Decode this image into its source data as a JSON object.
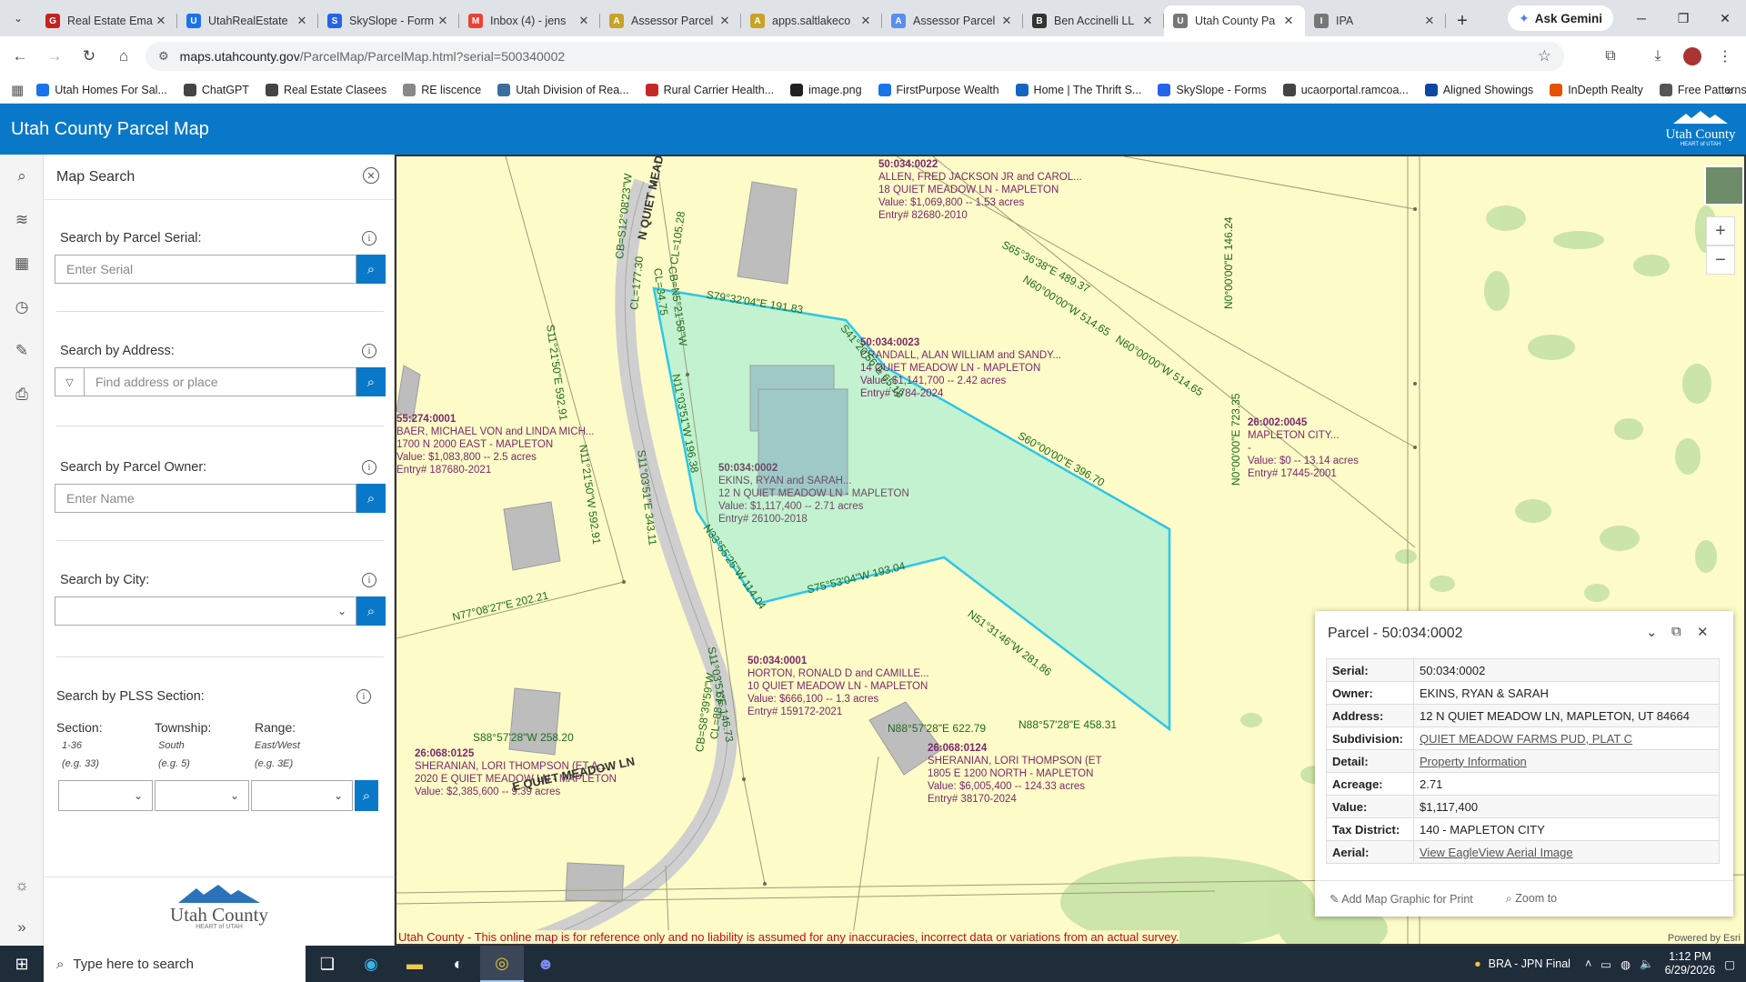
{
  "browser": {
    "tabs": [
      {
        "title": "Real Estate Ema",
        "color": "#c5221f",
        "glyph": "G"
      },
      {
        "title": "UtahRealEstate",
        "color": "#1a73e8",
        "glyph": "U"
      },
      {
        "title": "SkySlope - Form",
        "color": "#2563eb",
        "glyph": "S"
      },
      {
        "title": "Inbox (4) - jens",
        "color": "#ea4335",
        "glyph": "M"
      },
      {
        "title": "Assessor Parcel",
        "color": "#c9a227",
        "glyph": "A"
      },
      {
        "title": "apps.saltlakeco",
        "color": "#c9a227",
        "glyph": "A"
      },
      {
        "title": "Assessor Parcel",
        "color": "#5b8def",
        "glyph": "A"
      },
      {
        "title": "Ben Accinelli LL",
        "color": "#333333",
        "glyph": "B"
      },
      {
        "title": "Utah County Pa",
        "color": "#777777",
        "glyph": "U",
        "active": true
      },
      {
        "title": "IPA",
        "color": "#777777",
        "glyph": "I"
      }
    ],
    "gemini_label": "Ask Gemini",
    "url_host": "maps.utahcounty.gov",
    "url_path": "/ParcelMap/ParcelMap.html?serial=500340002",
    "bookmarks": [
      {
        "label": "Utah Homes For Sal...",
        "color": "#1a73e8"
      },
      {
        "label": "ChatGPT",
        "color": "#444444"
      },
      {
        "label": "Real Estate Clasees",
        "color": "#444444"
      },
      {
        "label": "RE liscence",
        "color": "#888888"
      },
      {
        "label": "Utah Division of Rea...",
        "color": "#3b6e9e"
      },
      {
        "label": "Rural Carrier Health...",
        "color": "#c62828"
      },
      {
        "label": "image.png",
        "color": "#222222"
      },
      {
        "label": "FirstPurpose Wealth",
        "color": "#1a73e8"
      },
      {
        "label": "Home | The Thrift S...",
        "color": "#1565c0"
      },
      {
        "label": "SkySlope - Forms",
        "color": "#2563eb"
      },
      {
        "label": "ucaorportal.ramcoa...",
        "color": "#444444"
      },
      {
        "label": "Aligned Showings",
        "color": "#0d47a1"
      },
      {
        "label": "InDepth Realty",
        "color": "#e65100"
      },
      {
        "label": "Free Patterns",
        "color": "#555555"
      }
    ]
  },
  "app": {
    "title": "Utah County Parcel Map",
    "logo_text": "Utah County",
    "logo_sub": "HEART of UTAH"
  },
  "panel": {
    "title": "Map Search",
    "serial_title": "Search by Parcel Serial:",
    "serial_placeholder": "Enter Serial",
    "address_title": "Search by Address:",
    "address_placeholder": "Find address or place",
    "owner_title": "Search by Parcel Owner:",
    "owner_placeholder": "Enter Name",
    "city_title": "Search by City:",
    "plss_title": "Search by PLSS Section:",
    "section_label": "Section:",
    "section_range": "1-36",
    "section_eg": "(e.g. 33)",
    "township_label": "Township:",
    "township_range": "South",
    "township_eg": "(e.g. 5)",
    "range_label": "Range:",
    "range_range": "East/West",
    "range_eg": "(e.g. 3E)"
  },
  "map": {
    "parcels": [
      {
        "id": "50:034:0022",
        "owner": "ALLEN, FRED JACKSON JR and CAROL...",
        "addr": "18  QUIET MEADOW LN - MAPLETON",
        "value": "Value: $1,069,800 -- 1.53 acres",
        "entry": "Entry# 82680-2010"
      },
      {
        "id": "50:034:0023",
        "owner": "CRANDALL, ALAN WILLIAM and SANDY...",
        "addr": "14  QUIET MEADOW LN - MAPLETON",
        "value": "Value: $1,141,700 -- 2.42 acres",
        "entry": "Entry# 5784-2024"
      },
      {
        "id": "55:274:0001",
        "owner": "BAER, MICHAEL VON and LINDA MICH...",
        "addr": "1700 N 2000 EAST  - MAPLETON",
        "value": "Value: $1,083,800 -- 2.5 acres",
        "entry": "Entry# 187680-2021"
      },
      {
        "id": "50:034:0002",
        "owner": "EKINS, RYAN and SARAH...",
        "addr": "12 N QUIET MEADOW LN - MAPLETON",
        "value": "Value: $1,117,400 -- 2.71 acres",
        "entry": "Entry# 26100-2018"
      },
      {
        "id": "26:002:0045",
        "owner": "MAPLETON CITY...",
        "addr": "-",
        "value": "Value: $0 -- 13.14 acres",
        "entry": "Entry# 17445-2001"
      },
      {
        "id": "50:034:0001",
        "owner": "HORTON, RONALD D and CAMILLE...",
        "addr": "10  QUIET MEADOW LN - MAPLETON",
        "value": "Value: $666,100 -- 1.3 acres",
        "entry": "Entry# 159172-2021"
      },
      {
        "id": "26:068:0125",
        "owner": "SHERANIAN, LORI THOMPSON (ET A...",
        "addr": "2020 E QUIET MEADOW LN - MAPLETON",
        "value": "Value: $2,385,600 -- 9.39 acres",
        "entry": ""
      },
      {
        "id": "26:068:0124",
        "owner": "SHERANIAN, LORI THOMPSON (ET",
        "addr": "1805 E 1200 NORTH  - MAPLETON",
        "value": "Value: $6,005,400 -- 124.33 acres",
        "entry": "Entry# 38170-2024"
      }
    ],
    "dims": {
      "d1": "S79°32'04\"E 191.83",
      "d2": "S41°20'56\"E 65.18",
      "d3": "S60°00'00\"E 396.70",
      "d4": "N11°03'51\"W 196.38",
      "d5": "N33°55'25\"W 114.04",
      "d6": "S75°53'04\"W 193.04",
      "d7": "N51°31'46\"W 281.86",
      "d8": "S11°03'51\"E 146.73",
      "d9": "S11°03'51\"E 343.11",
      "d10": "N77°08'27\"E 202.21",
      "d11": "N11°21'50\"W 592.91",
      "d12": "S11°21'50\"E 592.91",
      "d13": "CB=S12°08'23\"W",
      "d14": "CL=177.30",
      "d15": "CB=N5°21'58\"W",
      "d16": "CL=34.75",
      "d17": "CL=105.28",
      "d18": "S65°36'38\"E 489.37",
      "d19": "N60°00'00\"W 514.65",
      "d20": "N60°00'00\"W 514.65",
      "d21": "N0°00'00\"E 146.24",
      "d22": "N0°00'00\"E 723.35",
      "d23": "S88°57'28\"W 258.20",
      "d24": "N88°57'28\"E 622.79",
      "d25": "N88°57'28\"E 458.31",
      "d26": "CB=S8°39'59\"W",
      "d27": "CL=88.49"
    },
    "streets": {
      "s1": "N QUIET MEADOW LN",
      "s2": "E QUIET MEADOW LN"
    },
    "disclaimer": "Utah County - This online map is for reference only and no liability is assumed for any inaccuracies, incorrect data or variations from an actual survey.",
    "powered": "Powered by Esri"
  },
  "popup": {
    "title": "Parcel - 50:034:0002",
    "rows": [
      {
        "k": "Serial:",
        "v": "50:034:0002"
      },
      {
        "k": "Owner:",
        "v": "EKINS, RYAN & SARAH"
      },
      {
        "k": "Address:",
        "v": "12 N QUIET MEADOW LN, MAPLETON, UT 84664"
      },
      {
        "k": "Subdivision:",
        "v": "QUIET MEADOW FARMS PUD, PLAT C",
        "link": true
      },
      {
        "k": "Detail:",
        "v": "Property Information",
        "link": true
      },
      {
        "k": "Acreage:",
        "v": "2.71"
      },
      {
        "k": "Value:",
        "v": "$1,117,400"
      },
      {
        "k": "Tax District:",
        "v": "140 - MAPLETON CITY"
      },
      {
        "k": "Aerial:",
        "v": "View EagleView Aerial Image",
        "link": true
      }
    ],
    "add_graphic": "Add Map Graphic for Print",
    "zoom_to": "Zoom to"
  },
  "taskbar": {
    "search_placeholder": "Type here to search",
    "game": "BRA - JPN Final",
    "time": "1:12 PM",
    "date": "6/29/2026"
  }
}
